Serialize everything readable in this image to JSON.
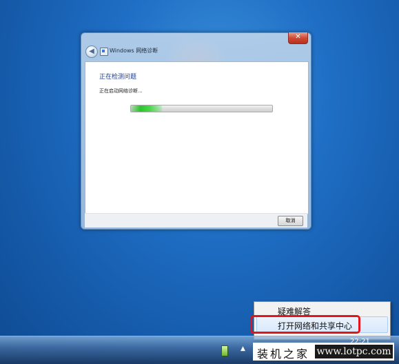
{
  "dialog": {
    "title": "Windows 网络诊断",
    "close_label": "✕",
    "back_label": "◀",
    "heading": "正在检测问题",
    "status_text": "正在启动网络诊断...",
    "progress": 0.22,
    "cancel_label": "取消"
  },
  "context_menu": {
    "items": [
      "疑难解答",
      "打开网络和共享中心"
    ]
  },
  "taskbar": {
    "tray_arrow": "▲",
    "clock_partial": "22:21"
  },
  "watermark": {
    "brand": "装机之家",
    "url": "www.lotpc.com"
  },
  "colors": {
    "desktop_blue": "#1f6fc6",
    "heading_blue": "#1e3b8a",
    "progress_green": "#2bc52b",
    "highlight_red": "#e3151c"
  }
}
